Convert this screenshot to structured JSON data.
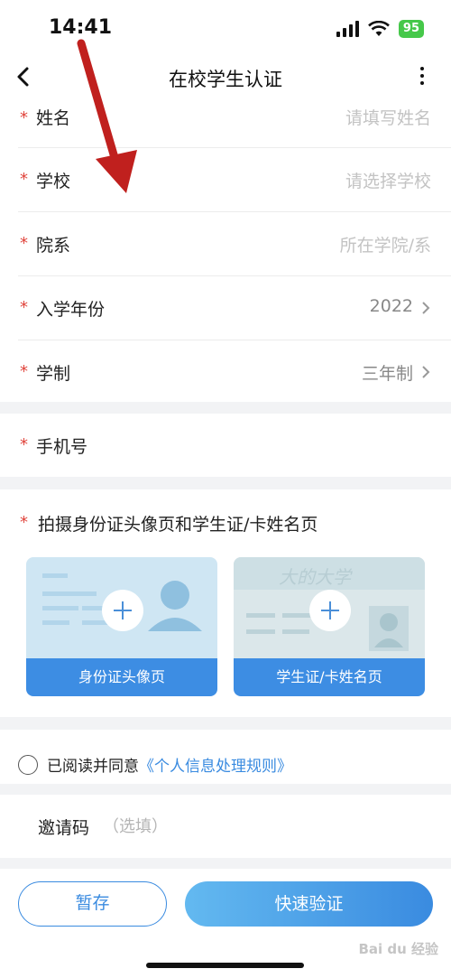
{
  "status": {
    "time": "14:41",
    "battery": "95"
  },
  "nav": {
    "title": "在校学生认证"
  },
  "form": {
    "name": {
      "label": "姓名",
      "placeholder": "请填写姓名"
    },
    "school": {
      "label": "学校",
      "placeholder": "请选择学校"
    },
    "department": {
      "label": "院系",
      "placeholder": "所在学院/系"
    },
    "enroll_year": {
      "label": "入学年份",
      "value": "2022"
    },
    "duration": {
      "label": "学制",
      "value": "三年制"
    },
    "phone": {
      "label": "手机号"
    }
  },
  "required_mark": "*",
  "photos": {
    "title": "拍摄身份证头像页和学生证/卡姓名页",
    "id_card": {
      "caption": "身份证头像页"
    },
    "student_card": {
      "caption": "学生证/卡姓名页",
      "card_text": "大的大学"
    }
  },
  "agreement": {
    "text": "已阅读并同意",
    "link": "《个人信息处理规则》"
  },
  "invite": {
    "label": "邀请码",
    "placeholder": "（选填）"
  },
  "buttons": {
    "save": "暂存",
    "verify": "快速验证"
  },
  "watermark": "Bai du 经验",
  "colors": {
    "accent": "#3a8be0",
    "required": "#e0443c",
    "annotation_arrow": "#c0201e"
  },
  "icons": [
    "back-icon",
    "more-icon",
    "chevron-right-icon",
    "plus-icon",
    "signal-icon",
    "wifi-icon",
    "battery-icon"
  ]
}
